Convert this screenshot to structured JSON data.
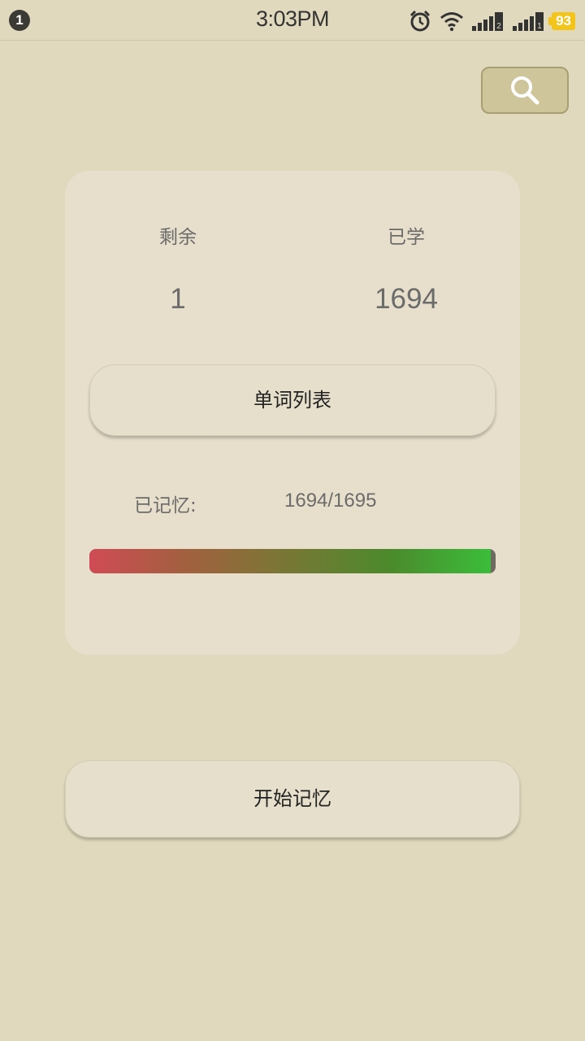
{
  "status_bar": {
    "notification_count": "1",
    "time": "3:03PM",
    "battery": "93",
    "sim1_label": "2",
    "sim2_label": "1",
    "icons": [
      "alarm-clock-icon",
      "wifi-icon",
      "signal-icon",
      "signal-icon",
      "battery-icon"
    ]
  },
  "search": {
    "icon": "search-icon"
  },
  "stats": {
    "remaining_label": "剩余",
    "remaining_value": "1",
    "learned_label": "已学",
    "learned_value": "1694"
  },
  "word_list_button": {
    "label": "单词列表"
  },
  "memorized": {
    "label": "已记忆:",
    "count": "1694/1695",
    "progress_fraction": 0.9994
  },
  "start_button": {
    "label": "开始记忆"
  },
  "colors": {
    "background": "#e0d9bd",
    "card": "#e7dfcc",
    "progress_start": "#d04b55",
    "progress_end": "#3bbd3a",
    "battery": "#f3c51b"
  }
}
